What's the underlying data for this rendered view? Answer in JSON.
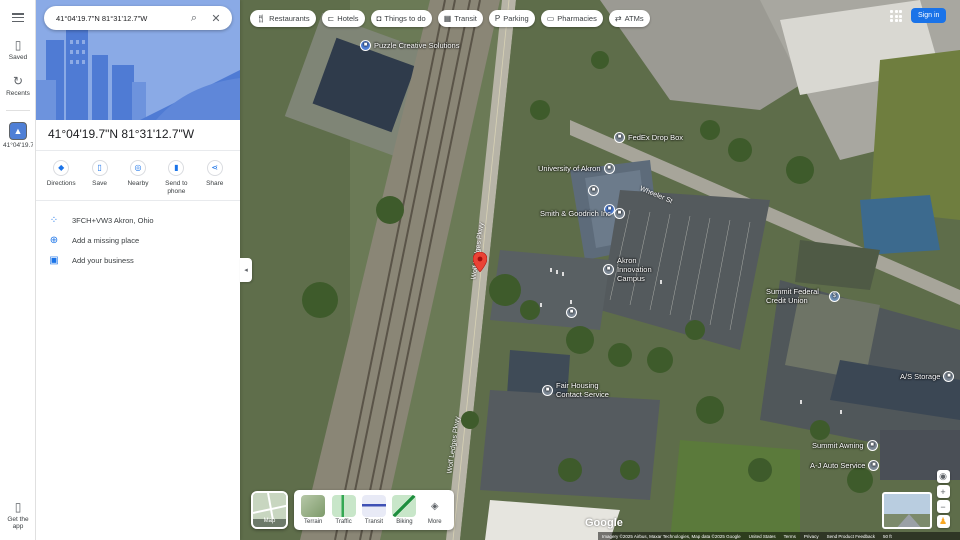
{
  "search": {
    "value": "41°04'19.7\"N 81°31'12.7\"W"
  },
  "rail": {
    "saved": "Saved",
    "recents": "Recents",
    "current": "41°04'19.7\"N...",
    "get_app": "Get the app"
  },
  "place": {
    "title": "41°04'19.7\"N 81°31'12.7\"W",
    "actions": [
      {
        "label": "Directions",
        "icon": "directions-icon"
      },
      {
        "label": "Save",
        "icon": "bookmark-icon"
      },
      {
        "label": "Nearby",
        "icon": "nearby-icon"
      },
      {
        "label": "Send to phone",
        "icon": "phone-icon"
      },
      {
        "label": "Share",
        "icon": "share-icon"
      }
    ],
    "plus_code": "3FCH+VW3 Akron, Ohio",
    "add_place": "Add a missing place",
    "add_business": "Add your business"
  },
  "chips": [
    {
      "label": "Restaurants",
      "icon": "restaurant-icon"
    },
    {
      "label": "Hotels",
      "icon": "hotel-icon"
    },
    {
      "label": "Things to do",
      "icon": "camera-icon"
    },
    {
      "label": "Transit",
      "icon": "transit-icon"
    },
    {
      "label": "Parking",
      "icon": "parking-icon"
    },
    {
      "label": "Pharmacies",
      "icon": "pharmacy-icon"
    },
    {
      "label": "ATMs",
      "icon": "atm-icon"
    }
  ],
  "signin": "Sign in",
  "map": {
    "pois": {
      "puzzle": "Puzzle Creative Solutions",
      "fedex": "FedEx Drop Box",
      "ua": "University of Akron",
      "smith": "Smith & Goodrich Inc",
      "aic": "Akron Innovation Campus",
      "summit": "Summit Federal Credit Union",
      "fair": "Fair Housing Contact Service",
      "afs": "A/S Storage",
      "summit_awning": "Summit Awning",
      "aj": "A-J Auto Service"
    },
    "roads": {
      "wolf1": "Wolf Ledges Pkwy",
      "wolf2": "Wolf Ledges Pkwy",
      "wheeler": "Wheeler St"
    }
  },
  "layers": {
    "main": "Map",
    "items": [
      "Terrain",
      "Traffic",
      "Transit",
      "Biking",
      "More"
    ]
  },
  "google": "Google",
  "attribution": {
    "imagery": "Imagery ©2025 Airbus, Maxar Technologies, Map data ©2025 Google",
    "us": "United States",
    "terms": "Terms",
    "privacy": "Privacy",
    "feedback": "Send Product Feedback",
    "scale": "50 ft"
  }
}
